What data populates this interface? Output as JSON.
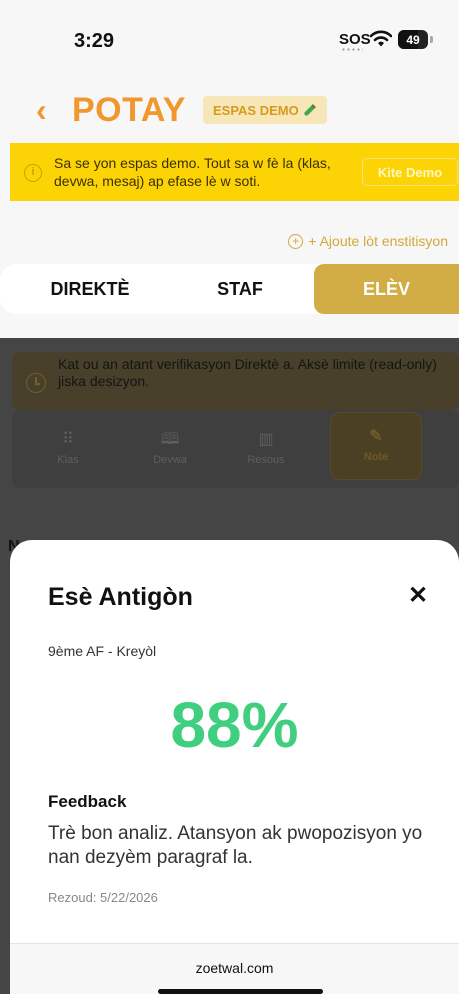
{
  "status_bar": {
    "time": "3:29",
    "sos": "SOS",
    "battery": "49"
  },
  "header": {
    "back_icon": "chevron-left-icon",
    "title": "POTAY",
    "demo_badge": "ESPAS DEMO"
  },
  "demo_banner": {
    "text": "Sa se yon espas demo. Tout sa w fè la (klas, devwa, mesaj) ap efase lè w soti.",
    "exit_label": "Kite Demo"
  },
  "add_institution": "+ Ajoute lòt enstitisyon",
  "role_tabs": [
    {
      "label": "DIREKTÈ",
      "active": false
    },
    {
      "label": "STAF",
      "active": false
    },
    {
      "label": "ELÈV",
      "active": true
    }
  ],
  "background": {
    "notice": "Kat ou an atant verifikasyon Direktè a. Aksè limite (read-only) jiska desizyon.",
    "nav": [
      {
        "label": "Klas",
        "icon": "grid-icon"
      },
      {
        "label": "Devwa",
        "icon": "book-icon"
      },
      {
        "label": "Resous",
        "icon": "library-icon"
      },
      {
        "label": "Note",
        "icon": "edit-icon"
      }
    ],
    "partial_char": "N"
  },
  "grade_sheet": {
    "title": "Esè Antigòn",
    "class": "9ème AF - Kreyòl",
    "score": "88%",
    "feedback_heading": "Feedback",
    "feedback": "Trè bon analiz. Atansyon ak pwopozisyon yo nan dezyèm paragraf la.",
    "returned": "Rezoud: 5/22/2026"
  },
  "browser": {
    "url": "zoetwal.com"
  },
  "colors": {
    "accent": "#f0972d",
    "gold": "#d2ac44",
    "banner": "#fcd406",
    "score": "#3fcf7f"
  }
}
